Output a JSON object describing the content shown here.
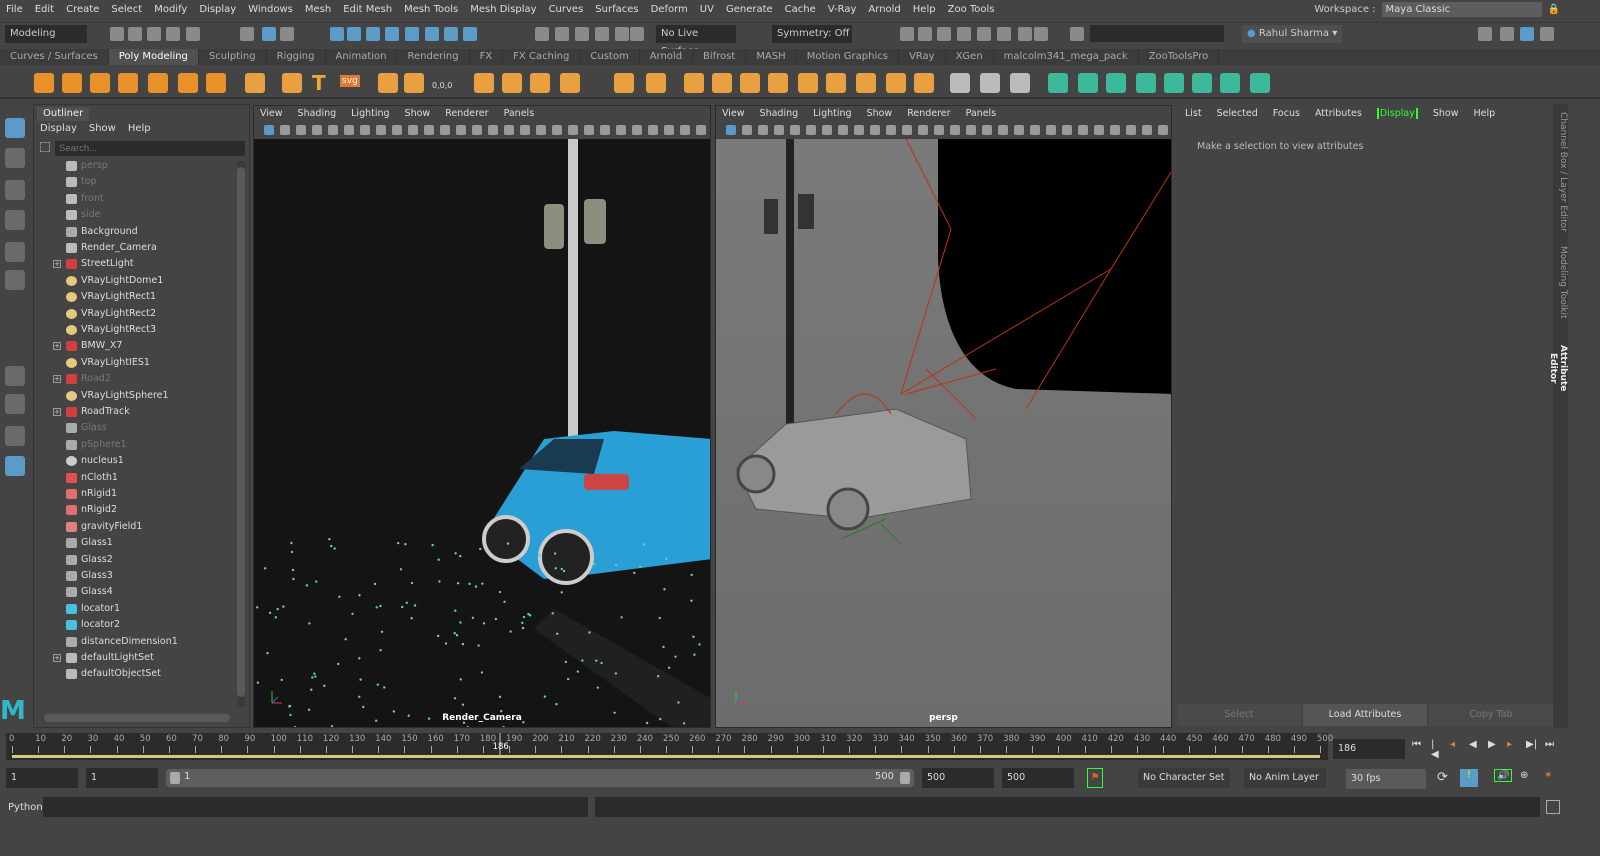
{
  "menubar": [
    "File",
    "Edit",
    "Create",
    "Select",
    "Modify",
    "Display",
    "Windows",
    "Mesh",
    "Edit Mesh",
    "Mesh Tools",
    "Mesh Display",
    "Curves",
    "Surfaces",
    "Deform",
    "UV",
    "Generate",
    "Cache",
    "V-Ray",
    "Arnold",
    "Help",
    "Zoo Tools"
  ],
  "workspace": {
    "label": "Workspace :",
    "value": "Maya Classic"
  },
  "status_line": {
    "mode": "Modeling",
    "live_surface": "No Live Surface",
    "symmetry": "Symmetry: Off",
    "user": "Rahul Sharma"
  },
  "shelf_tabs": [
    "Curves / Surfaces",
    "Poly Modeling",
    "Sculpting",
    "Rigging",
    "Animation",
    "Rendering",
    "FX",
    "FX Caching",
    "Custom",
    "Arnold",
    "Bifrost",
    "MASH",
    "Motion Graphics",
    "VRay",
    "XGen",
    "malcolm341_mega_pack",
    "ZooToolsPro"
  ],
  "shelf_active": "Poly Modeling",
  "shelf_text": {
    "text_tool": "T",
    "svg_tool": "svg",
    "coord": "0,0,0"
  },
  "outliner": {
    "title": "Outliner",
    "menu": [
      "Display",
      "Show",
      "Help"
    ],
    "search_placeholder": "Search...",
    "items": [
      {
        "label": "persp",
        "icon": "camera",
        "dim": true
      },
      {
        "label": "top",
        "icon": "camera",
        "dim": true
      },
      {
        "label": "front",
        "icon": "camera",
        "dim": true
      },
      {
        "label": "side",
        "icon": "camera",
        "dim": true
      },
      {
        "label": "Background",
        "icon": "transform"
      },
      {
        "label": "Render_Camera",
        "icon": "camera"
      },
      {
        "label": "StreetLight",
        "icon": "group",
        "expand": true
      },
      {
        "label": "VRayLightDome1",
        "icon": "light"
      },
      {
        "label": "VRayLightRect1",
        "icon": "light"
      },
      {
        "label": "VRayLightRect2",
        "icon": "light"
      },
      {
        "label": "VRayLightRect3",
        "icon": "light"
      },
      {
        "label": "BMW_X7",
        "icon": "group",
        "expand": true
      },
      {
        "label": "VRayLightIES1",
        "icon": "light"
      },
      {
        "label": "Road2",
        "icon": "group",
        "expand": true,
        "dim": true
      },
      {
        "label": "VRayLightSphere1",
        "icon": "light"
      },
      {
        "label": "RoadTrack",
        "icon": "group",
        "expand": true
      },
      {
        "label": "Glass",
        "icon": "transform",
        "dim": true
      },
      {
        "label": "pSphere1",
        "icon": "transform",
        "dim": true
      },
      {
        "label": "nucleus1",
        "icon": "nucleus"
      },
      {
        "label": "nCloth1",
        "icon": "ncloth"
      },
      {
        "label": "nRigid1",
        "icon": "nrigid"
      },
      {
        "label": "nRigid2",
        "icon": "nrigid"
      },
      {
        "label": "gravityField1",
        "icon": "field"
      },
      {
        "label": "Glass1",
        "icon": "transform"
      },
      {
        "label": "Glass2",
        "icon": "transform"
      },
      {
        "label": "Glass3",
        "icon": "transform"
      },
      {
        "label": "Glass4",
        "icon": "transform"
      },
      {
        "label": "locator1",
        "icon": "locator"
      },
      {
        "label": "locator2",
        "icon": "locator"
      },
      {
        "label": "distanceDimension1",
        "icon": "dimension"
      },
      {
        "label": "defaultLightSet",
        "icon": "set",
        "expand": true
      },
      {
        "label": "defaultObjectSet",
        "icon": "set"
      }
    ]
  },
  "viewport_menu": [
    "View",
    "Shading",
    "Lighting",
    "Show",
    "Renderer",
    "Panels"
  ],
  "viewports": [
    {
      "camera": "Render_Camera"
    },
    {
      "camera": "persp"
    }
  ],
  "attribute_editor": {
    "menu": [
      "List",
      "Selected",
      "Focus",
      "Attributes",
      "Display",
      "Show",
      "Help"
    ],
    "active_menu": "Display",
    "message": "Make a selection to view attributes",
    "buttons": [
      "Select",
      "Load Attributes",
      "Copy Tab"
    ]
  },
  "side_tabs": [
    "Channel Box / Layer Editor",
    "Modeling Toolkit",
    "Attribute Editor"
  ],
  "timeline": {
    "start": 0,
    "end": 500,
    "step": 10,
    "current_frame": 186,
    "current_frame_field": "186"
  },
  "range": {
    "start_field": "1",
    "playback_start": "1",
    "slider_start": "1",
    "slider_end": "500",
    "playback_end": "500",
    "end_field": "500",
    "character_set": "No Character Set",
    "anim_layer": "No Anim Layer",
    "fps": "30 fps"
  },
  "command_line": {
    "label": "Python"
  },
  "colors": {
    "accent_blue": "#5b9bc8",
    "active_green": "#2cff2c",
    "timeline_range": "#d8c67a"
  }
}
